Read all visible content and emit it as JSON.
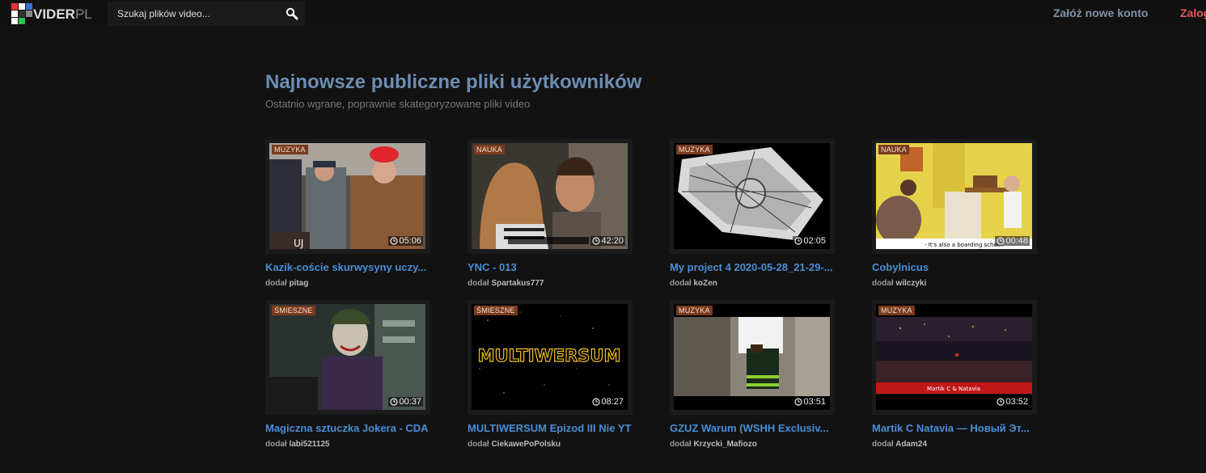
{
  "header": {
    "logo_main": "VIDER",
    "logo_suffix": "PL",
    "search_placeholder": "Szukaj plików video...",
    "register_label": "Załóż nowe konto",
    "login_label": "Zaloguj"
  },
  "page": {
    "title": "Najnowsze publiczne pliki użytkowników",
    "subtitle": "Ostatnio wgrane, poprawnie skategoryzowane pliki video"
  },
  "videos": [
    {
      "category": "MUZYKA",
      "duration": "05:06",
      "title": "Kazik-coście skurwysyny uczy...",
      "added_prefix": "dodał",
      "author": "pitag",
      "overlay": ""
    },
    {
      "category": "NAUKA",
      "duration": "42:20",
      "title": "YNC - 013",
      "added_prefix": "dodał",
      "author": "Spartakus777",
      "overlay": ""
    },
    {
      "category": "MUZYKA",
      "duration": "02:05",
      "title": "My project 4 2020-05-28_21-29-...",
      "added_prefix": "dodał",
      "author": "koZen",
      "overlay": ""
    },
    {
      "category": "NAUKA",
      "duration": "00:48",
      "title": "Cobylnicus",
      "added_prefix": "dodał",
      "author": "wilczyki",
      "overlay": "- It's also a boarding school."
    },
    {
      "category": "ŚMIESZNE",
      "duration": "00:37",
      "title": "Magiczna sztuczka Jokera - CDA",
      "added_prefix": "dodał",
      "author": "labi521125",
      "overlay": ""
    },
    {
      "category": "ŚMIESZNE",
      "duration": "08:27",
      "title": "MULTIWERSUM Epizod III Nie YT",
      "added_prefix": "dodał",
      "author": "CiekawePoPolsku",
      "overlay": "MULTIWERSUM"
    },
    {
      "category": "MUZYKA",
      "duration": "03:51",
      "title": "GZUZ Warum (WSHH Exclusiv...",
      "added_prefix": "dodał",
      "author": "Krzycki_Mafiozo",
      "overlay": ""
    },
    {
      "category": "MUZYKA",
      "duration": "03:52",
      "title": "Martik C Natavia — Новый Эт...",
      "added_prefix": "dodał",
      "author": "Adam24",
      "overlay": "Martik C & Natavia"
    }
  ],
  "colors": {
    "background": "#121212",
    "title_link": "#4a8ed6",
    "heading": "#6d8db3",
    "category_badge": "#7a3a1e",
    "login_link": "#e85a5a"
  },
  "icons": {
    "search": "magnifier-icon",
    "duration": "clock-icon",
    "logo": "pixel-logo-icon"
  }
}
